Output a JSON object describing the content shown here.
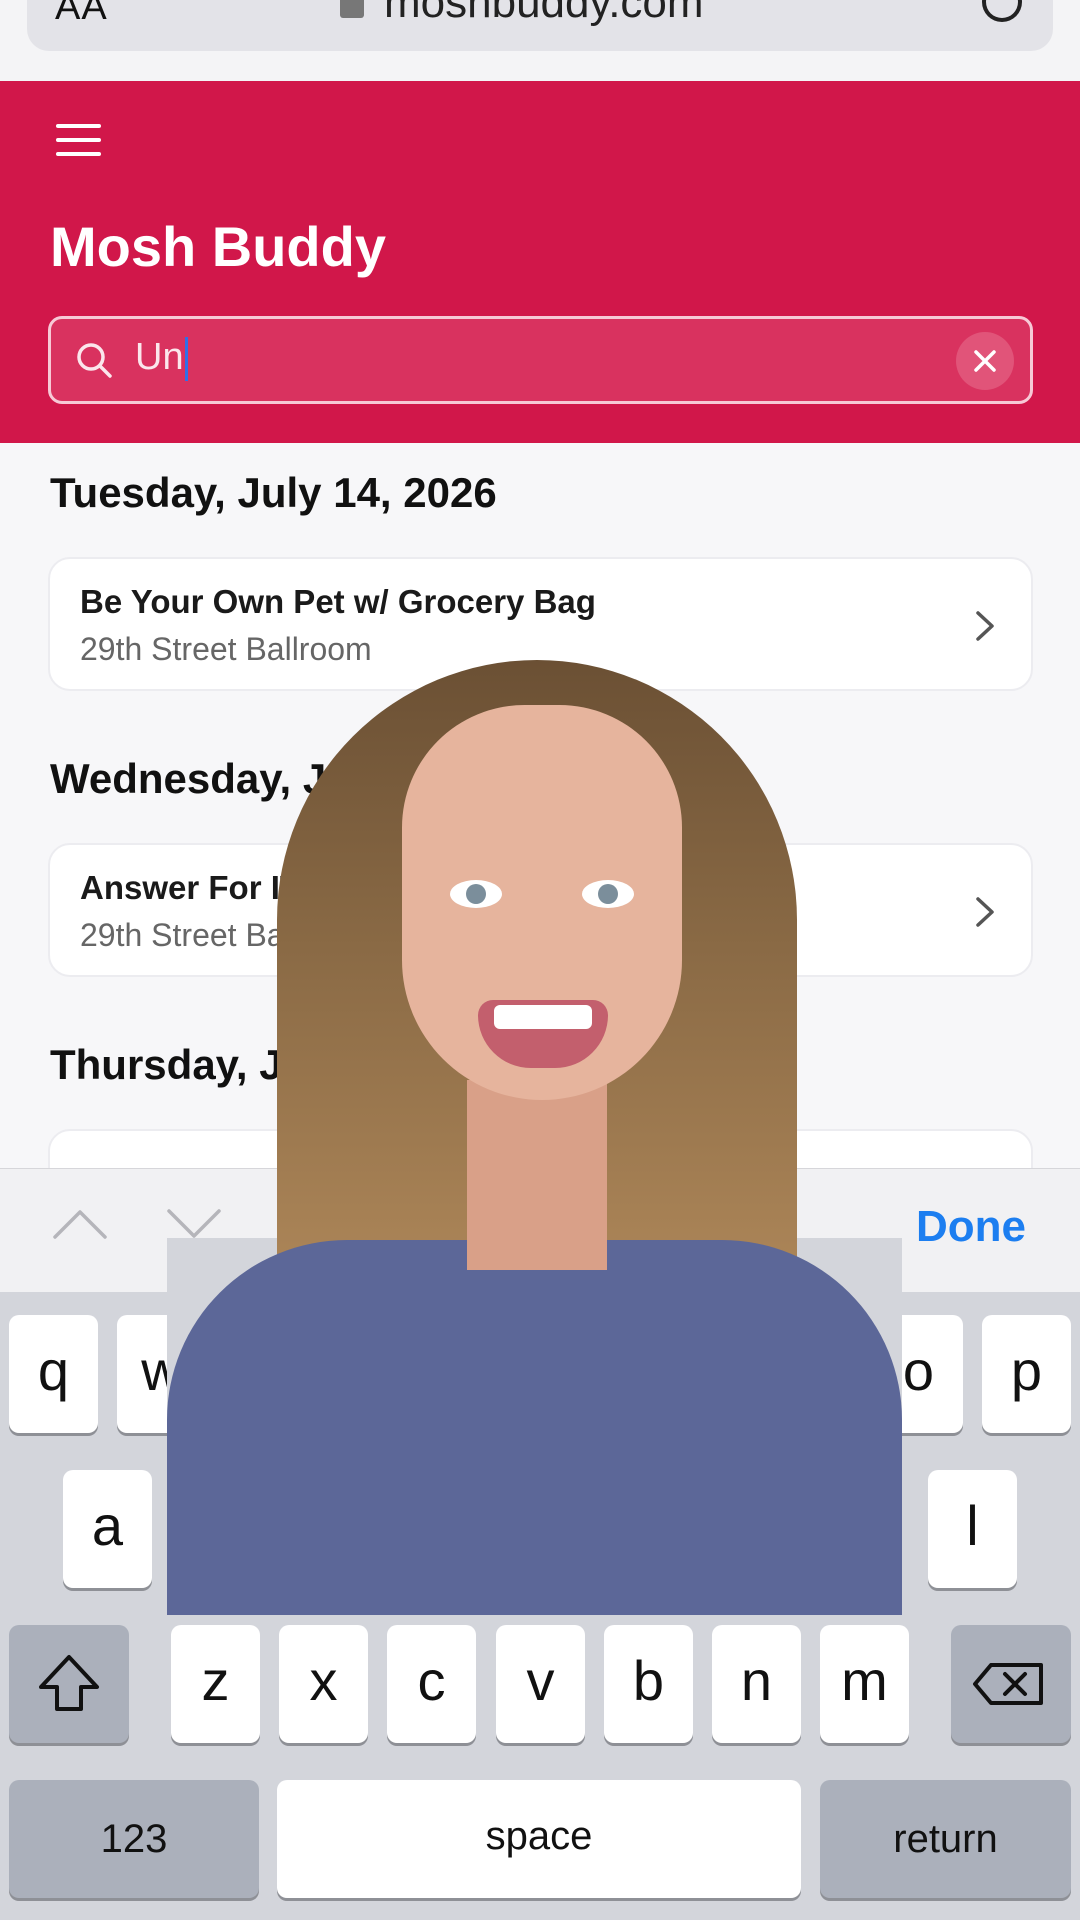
{
  "browser": {
    "aa_label": "AA",
    "url": "moshbuddy.com"
  },
  "header": {
    "title": "Mosh Buddy",
    "search_value": "Un"
  },
  "days": [
    {
      "label": "Tuesday, July 14, 2026",
      "event": {
        "title": "Be Your Own Pet w/ Grocery Bag",
        "venue": "29th Street Ballroom"
      }
    },
    {
      "label": "Wednesday, July",
      "event": {
        "title": "Answer For IT!",
        "venue": "29th Street Ballro"
      }
    },
    {
      "label": "Thursday, Ju",
      "event": {
        "title": "",
        "venue": ""
      }
    }
  ],
  "toolbar": {
    "done_label": "Done"
  },
  "keyboard": {
    "row1": [
      "q",
      "w",
      "o",
      "p"
    ],
    "row2": [
      "a",
      "l"
    ],
    "row3": [
      "z",
      "x",
      "c",
      "v",
      "b",
      "n",
      "m"
    ],
    "numbers_label": "123",
    "space_label": "space",
    "return_label": "return"
  },
  "colors": {
    "brand": "#d1174a",
    "done": "#1c7ef0"
  },
  "icons": {
    "search": "search-icon",
    "clear": "close-icon",
    "menu": "hamburger-icon",
    "chevron": "chevron-right-icon",
    "shift": "shift-icon",
    "delete": "backspace-icon"
  }
}
